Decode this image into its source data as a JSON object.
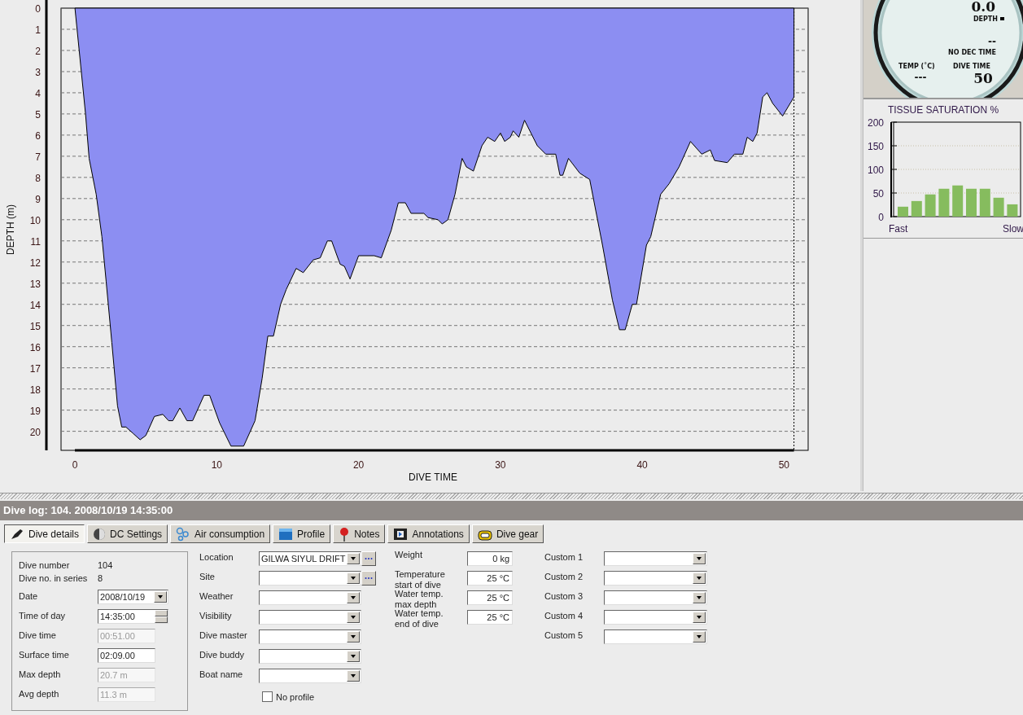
{
  "profile": {
    "chart_data": {
      "type": "area",
      "xlabel": "DIVE TIME",
      "ylabel": "DEPTH (m)",
      "x": [
        0,
        0.75,
        1.0,
        1.5,
        1.9,
        2.2,
        2.6,
        3.0,
        3.3,
        3.6,
        4.1,
        4.6,
        5.0,
        5.6,
        6.2,
        6.6,
        6.9,
        7.4,
        7.9,
        8.3,
        9.1,
        9.5,
        10.2,
        11.0,
        11.9,
        12.7,
        13.2,
        13.6,
        14.0,
        14.5,
        14.9,
        15.6,
        16.1,
        16.8,
        17.3,
        17.8,
        18.1,
        18.7,
        19.0,
        19.4,
        20.0,
        21.1,
        21.6,
        22.3,
        22.8,
        23.3,
        23.7,
        24.6,
        24.9,
        25.6,
        25.9,
        26.3,
        26.8,
        27.3,
        27.6,
        28.1,
        28.7,
        29.1,
        29.6,
        30.0,
        30.3,
        30.7,
        30.9,
        31.3,
        31.7,
        32.6,
        33.2,
        33.9,
        34.2,
        34.4,
        34.8,
        35.6,
        36.3,
        37.2,
        37.9,
        38.4,
        38.8,
        39.3,
        39.6,
        40.3,
        40.6,
        41.3,
        41.9,
        42.6,
        43.4,
        44.2,
        44.8,
        45.1,
        46.0,
        46.5,
        47.1,
        47.4,
        47.8,
        48.1,
        48.5,
        48.8,
        49.2,
        49.9,
        50.7
      ],
      "series": [
        {
          "color": "#8c8ef2",
          "values": [
            0,
            5,
            7.1,
            8.8,
            10.8,
            12.9,
            15.8,
            18.8,
            19.8,
            19.8,
            20.1,
            20.4,
            20.2,
            19.3,
            19.2,
            19.5,
            19.5,
            18.9,
            19.5,
            19.5,
            18.3,
            18.3,
            19.6,
            20.7,
            20.7,
            19.5,
            17.5,
            15.5,
            15.5,
            14.0,
            13.3,
            12.3,
            12.5,
            11.9,
            11.8,
            11.0,
            11.0,
            12.1,
            12.2,
            12.8,
            11.7,
            11.7,
            11.8,
            10.5,
            9.2,
            9.2,
            9.7,
            9.7,
            9.9,
            10.0,
            10.2,
            10.0,
            8.8,
            7.1,
            7.5,
            7.7,
            6.5,
            6.1,
            6.3,
            5.9,
            6.3,
            6.1,
            5.8,
            6.1,
            5.3,
            6.5,
            6.9,
            6.9,
            7.9,
            7.9,
            7.1,
            7.8,
            8.1,
            11.2,
            13.8,
            15.2,
            15.2,
            14.0,
            14.0,
            11.2,
            10.8,
            8.8,
            8.3,
            7.5,
            6.3,
            6.9,
            6.7,
            7.2,
            7.3,
            6.9,
            6.9,
            6.1,
            6.3,
            5.9,
            4.2,
            4.0,
            4.5,
            5.1,
            4.2
          ]
        }
      ],
      "xlim": [
        -0.98,
        51.7
      ],
      "ylim": [
        20.9,
        0
      ],
      "grid": true,
      "ref_lines": [
        {
          "axis": "x",
          "value": 50.7
        }
      ],
      "xticks": [
        0,
        10,
        20,
        30,
        40,
        50
      ],
      "yticks": [
        0,
        1,
        2,
        3,
        4,
        5,
        6,
        7,
        8,
        9,
        10,
        11,
        12,
        13,
        14,
        15,
        16,
        17,
        18,
        19,
        20
      ]
    }
  },
  "gauge": {
    "depth_value": "0.0",
    "depth_label": "DEPTH",
    "no_dec_value": "--",
    "no_dec_label": "NO DEC TIME",
    "temp_label": "TEMP (˚C)",
    "temp_value": "---",
    "dive_time_label": "DIVE TIME",
    "dive_time_value": "50"
  },
  "tissue": {
    "title": "TISSUE SATURATION %",
    "fast_label": "Fast",
    "slow_label": "Slow",
    "chart_data": {
      "type": "bar",
      "series": [
        {
          "color": "#86bc5e",
          "values": [
            21,
            33,
            47,
            59,
            66,
            59,
            59,
            40,
            26
          ]
        }
      ],
      "ylim": [
        0,
        200
      ],
      "yticks": [
        0,
        50,
        100,
        150,
        200
      ],
      "grid": true
    }
  },
  "dive_log_title": "Dive log: 104. 2008/10/19 14:35:00",
  "tabs": [
    {
      "label": "Dive details",
      "selected": true
    },
    {
      "label": "DC Settings",
      "selected": false
    },
    {
      "label": "Air consumption",
      "selected": false
    },
    {
      "label": "Profile",
      "selected": false
    },
    {
      "label": "Notes",
      "selected": false
    },
    {
      "label": "Annotations",
      "selected": false
    },
    {
      "label": "Dive gear",
      "selected": false
    }
  ],
  "details": {
    "info": [
      {
        "label": "Dive number",
        "value": "104"
      },
      {
        "label": "Dive no. in series",
        "value": "8"
      }
    ],
    "fields": [
      {
        "label": "Date",
        "value": "2008/10/19",
        "kind": "dropdown"
      },
      {
        "label": "Time of day",
        "value": "14:35:00",
        "kind": "spin"
      },
      {
        "label": "Dive time",
        "value": "00:51.00",
        "kind": "text",
        "disabled": true
      },
      {
        "label": "Surface time",
        "value": "02:09.00",
        "kind": "text",
        "disabled": false
      },
      {
        "label": "Max depth",
        "value": "20.7 m",
        "kind": "text",
        "disabled": true
      },
      {
        "label": "Avg depth",
        "value": "11.3 m",
        "kind": "text",
        "disabled": true
      }
    ]
  },
  "site_fields": [
    {
      "label": "Location",
      "value": "GILWA SIYUL DRIFT",
      "browse": true
    },
    {
      "label": "Site",
      "browse": true
    },
    {
      "label": "Weather",
      "browse": false
    },
    {
      "label": "Visibility",
      "browse": false
    },
    {
      "label": "Dive master",
      "browse": false
    },
    {
      "label": "Dive buddy",
      "browse": false
    },
    {
      "label": "Boat name",
      "browse": false
    }
  ],
  "no_profile": {
    "label": "No profile",
    "checked": false
  },
  "measurements": [
    {
      "label": "Weight",
      "value": "0 kg"
    },
    {
      "label": "Temperature\nstart of dive",
      "value": "25 °C"
    },
    {
      "label": "Water temp.\nmax depth",
      "value": "25 °C"
    },
    {
      "label": "Water temp.\nend of dive",
      "value": "25 °C"
    }
  ],
  "custom_fields": [
    {
      "label": "Custom 1"
    },
    {
      "label": "Custom 2"
    },
    {
      "label": "Custom 3"
    },
    {
      "label": "Custom 4"
    },
    {
      "label": "Custom 5"
    }
  ]
}
